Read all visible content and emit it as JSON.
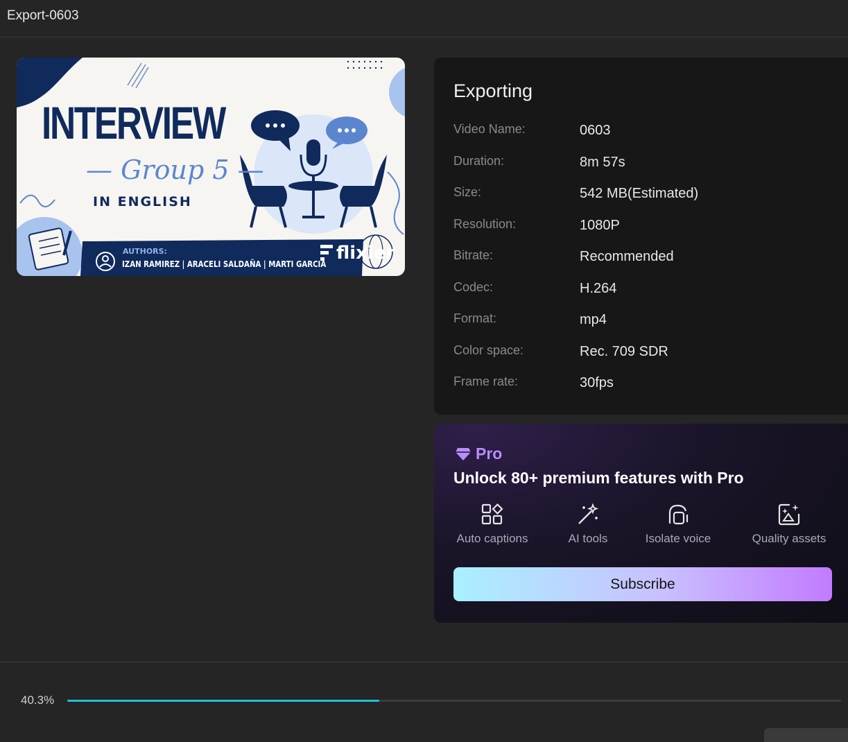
{
  "window": {
    "title": "Export-0603"
  },
  "thumbnail": {
    "title": "INTERVIEW",
    "subtitle": "— Group 5 —",
    "language": "IN ENGLISH",
    "authors_label": "AUTHORS:",
    "authors": "IZAN RAMIREZ  |  ARACELI SALDAÑA  |  MARTI GARCIA",
    "watermark": "flixier"
  },
  "info": {
    "heading": "Exporting",
    "rows": [
      {
        "label": "Video Name:",
        "value": "0603"
      },
      {
        "label": "Duration:",
        "value": "8m 57s"
      },
      {
        "label": "Size:",
        "value": "542 MB(Estimated)"
      },
      {
        "label": "Resolution:",
        "value": "1080P"
      },
      {
        "label": "Bitrate:",
        "value": "Recommended"
      },
      {
        "label": "Codec:",
        "value": "H.264"
      },
      {
        "label": "Format:",
        "value": "mp4"
      },
      {
        "label": "Color space:",
        "value": "Rec. 709 SDR"
      },
      {
        "label": "Frame rate:",
        "value": "30fps"
      }
    ]
  },
  "pro": {
    "badge": "Pro",
    "headline": "Unlock 80+ premium features with Pro",
    "features": [
      {
        "label": "Auto captions",
        "icon": "grid-shapes-icon"
      },
      {
        "label": "AI tools",
        "icon": "magic-wand-icon"
      },
      {
        "label": "Isolate voice",
        "icon": "isolate-voice-icon"
      },
      {
        "label": "Quality assets",
        "icon": "image-sparkle-icon"
      }
    ],
    "subscribe_label": "Subscribe"
  },
  "progress": {
    "percent": 40.3,
    "label": "40.3%"
  },
  "colors": {
    "accent": "#1fc3d6",
    "pro": "#b98cff",
    "navy": "#102a5c"
  }
}
